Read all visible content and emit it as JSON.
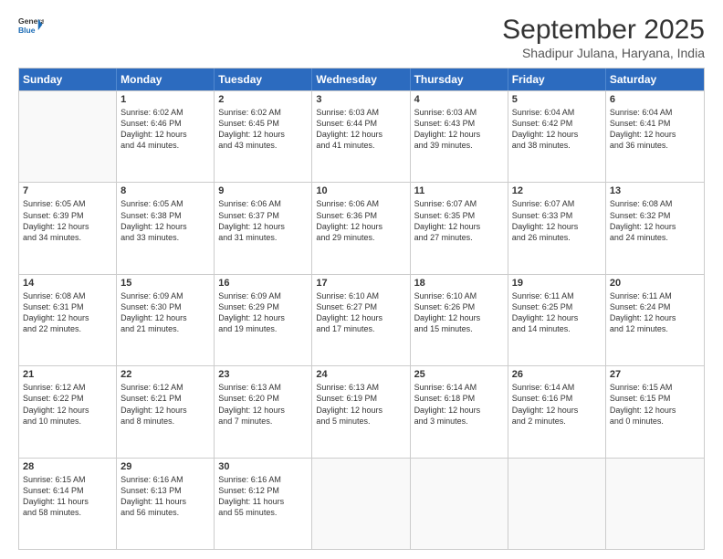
{
  "logo": {
    "line1": "General",
    "line2": "Blue"
  },
  "title": "September 2025",
  "subtitle": "Shadipur Julana, Haryana, India",
  "headers": [
    "Sunday",
    "Monday",
    "Tuesday",
    "Wednesday",
    "Thursday",
    "Friday",
    "Saturday"
  ],
  "weeks": [
    [
      {
        "day": "",
        "info": ""
      },
      {
        "day": "1",
        "info": "Sunrise: 6:02 AM\nSunset: 6:46 PM\nDaylight: 12 hours\nand 44 minutes."
      },
      {
        "day": "2",
        "info": "Sunrise: 6:02 AM\nSunset: 6:45 PM\nDaylight: 12 hours\nand 43 minutes."
      },
      {
        "day": "3",
        "info": "Sunrise: 6:03 AM\nSunset: 6:44 PM\nDaylight: 12 hours\nand 41 minutes."
      },
      {
        "day": "4",
        "info": "Sunrise: 6:03 AM\nSunset: 6:43 PM\nDaylight: 12 hours\nand 39 minutes."
      },
      {
        "day": "5",
        "info": "Sunrise: 6:04 AM\nSunset: 6:42 PM\nDaylight: 12 hours\nand 38 minutes."
      },
      {
        "day": "6",
        "info": "Sunrise: 6:04 AM\nSunset: 6:41 PM\nDaylight: 12 hours\nand 36 minutes."
      }
    ],
    [
      {
        "day": "7",
        "info": "Sunrise: 6:05 AM\nSunset: 6:39 PM\nDaylight: 12 hours\nand 34 minutes."
      },
      {
        "day": "8",
        "info": "Sunrise: 6:05 AM\nSunset: 6:38 PM\nDaylight: 12 hours\nand 33 minutes."
      },
      {
        "day": "9",
        "info": "Sunrise: 6:06 AM\nSunset: 6:37 PM\nDaylight: 12 hours\nand 31 minutes."
      },
      {
        "day": "10",
        "info": "Sunrise: 6:06 AM\nSunset: 6:36 PM\nDaylight: 12 hours\nand 29 minutes."
      },
      {
        "day": "11",
        "info": "Sunrise: 6:07 AM\nSunset: 6:35 PM\nDaylight: 12 hours\nand 27 minutes."
      },
      {
        "day": "12",
        "info": "Sunrise: 6:07 AM\nSunset: 6:33 PM\nDaylight: 12 hours\nand 26 minutes."
      },
      {
        "day": "13",
        "info": "Sunrise: 6:08 AM\nSunset: 6:32 PM\nDaylight: 12 hours\nand 24 minutes."
      }
    ],
    [
      {
        "day": "14",
        "info": "Sunrise: 6:08 AM\nSunset: 6:31 PM\nDaylight: 12 hours\nand 22 minutes."
      },
      {
        "day": "15",
        "info": "Sunrise: 6:09 AM\nSunset: 6:30 PM\nDaylight: 12 hours\nand 21 minutes."
      },
      {
        "day": "16",
        "info": "Sunrise: 6:09 AM\nSunset: 6:29 PM\nDaylight: 12 hours\nand 19 minutes."
      },
      {
        "day": "17",
        "info": "Sunrise: 6:10 AM\nSunset: 6:27 PM\nDaylight: 12 hours\nand 17 minutes."
      },
      {
        "day": "18",
        "info": "Sunrise: 6:10 AM\nSunset: 6:26 PM\nDaylight: 12 hours\nand 15 minutes."
      },
      {
        "day": "19",
        "info": "Sunrise: 6:11 AM\nSunset: 6:25 PM\nDaylight: 12 hours\nand 14 minutes."
      },
      {
        "day": "20",
        "info": "Sunrise: 6:11 AM\nSunset: 6:24 PM\nDaylight: 12 hours\nand 12 minutes."
      }
    ],
    [
      {
        "day": "21",
        "info": "Sunrise: 6:12 AM\nSunset: 6:22 PM\nDaylight: 12 hours\nand 10 minutes."
      },
      {
        "day": "22",
        "info": "Sunrise: 6:12 AM\nSunset: 6:21 PM\nDaylight: 12 hours\nand 8 minutes."
      },
      {
        "day": "23",
        "info": "Sunrise: 6:13 AM\nSunset: 6:20 PM\nDaylight: 12 hours\nand 7 minutes."
      },
      {
        "day": "24",
        "info": "Sunrise: 6:13 AM\nSunset: 6:19 PM\nDaylight: 12 hours\nand 5 minutes."
      },
      {
        "day": "25",
        "info": "Sunrise: 6:14 AM\nSunset: 6:18 PM\nDaylight: 12 hours\nand 3 minutes."
      },
      {
        "day": "26",
        "info": "Sunrise: 6:14 AM\nSunset: 6:16 PM\nDaylight: 12 hours\nand 2 minutes."
      },
      {
        "day": "27",
        "info": "Sunrise: 6:15 AM\nSunset: 6:15 PM\nDaylight: 12 hours\nand 0 minutes."
      }
    ],
    [
      {
        "day": "28",
        "info": "Sunrise: 6:15 AM\nSunset: 6:14 PM\nDaylight: 11 hours\nand 58 minutes."
      },
      {
        "day": "29",
        "info": "Sunrise: 6:16 AM\nSunset: 6:13 PM\nDaylight: 11 hours\nand 56 minutes."
      },
      {
        "day": "30",
        "info": "Sunrise: 6:16 AM\nSunset: 6:12 PM\nDaylight: 11 hours\nand 55 minutes."
      },
      {
        "day": "",
        "info": ""
      },
      {
        "day": "",
        "info": ""
      },
      {
        "day": "",
        "info": ""
      },
      {
        "day": "",
        "info": ""
      }
    ]
  ]
}
